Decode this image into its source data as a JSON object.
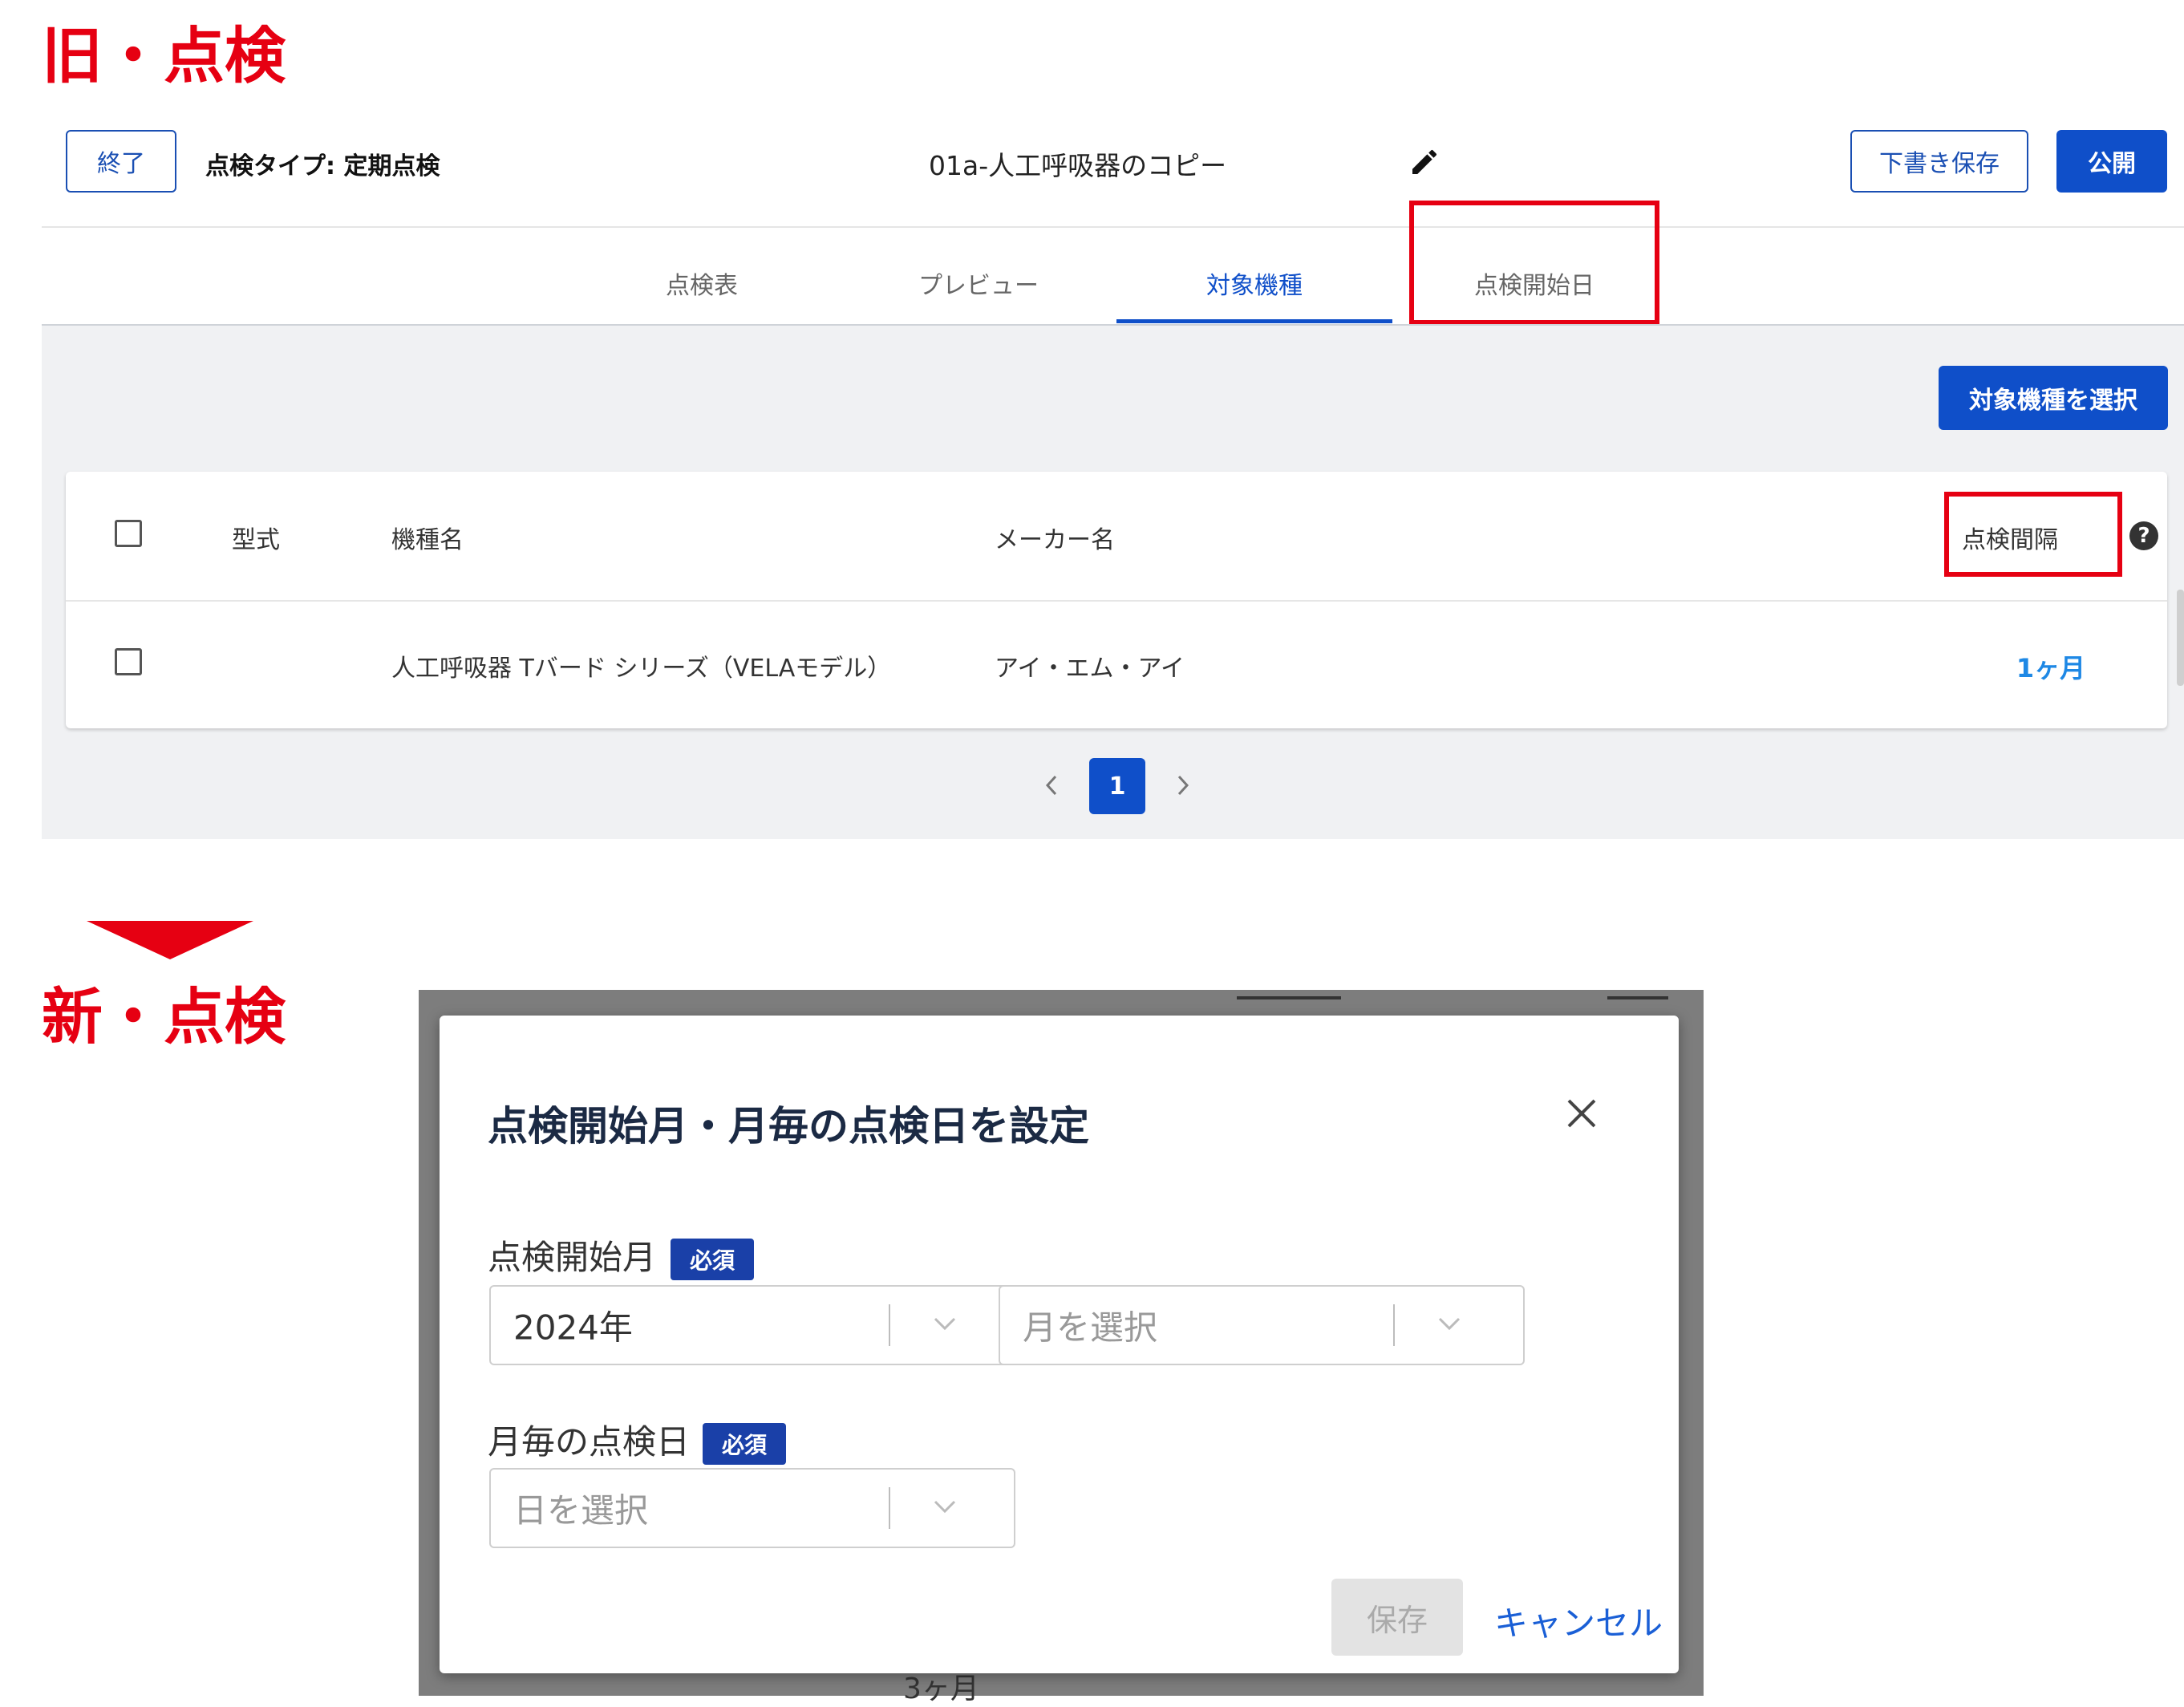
{
  "labels": {
    "old": "旧・点検",
    "new": "新・点検"
  },
  "old_screen": {
    "header": {
      "exit_label": "終了",
      "inspection_type": "点検タイプ: 定期点検",
      "document_title": "01a-人工呼吸器のコピー",
      "draft_save_label": "下書き保存",
      "publish_label": "公開"
    },
    "tabs": [
      {
        "label": "点検表"
      },
      {
        "label": "プレビュー"
      },
      {
        "label": "対象機種"
      },
      {
        "label": "点検開始日"
      }
    ],
    "select_models_label": "対象機種を選択",
    "table": {
      "columns": {
        "model_code": "型式",
        "model_name": "機種名",
        "maker": "メーカー名",
        "interval": "点検間隔"
      },
      "rows": [
        {
          "model_code": "",
          "model_name": "人工呼吸器 Tバード シリーズ（VELAモデル）",
          "maker": "アイ・エム・アイ",
          "interval": "1ヶ月"
        }
      ]
    },
    "pagination": {
      "current_page": "1"
    }
  },
  "new_screen": {
    "dialog": {
      "title": "点検開始月・月毎の点検日を設定",
      "start_month_label": "点検開始月",
      "required_badge": "必須",
      "year_value": "2024年",
      "month_placeholder": "月を選択",
      "day_label": "月毎の点検日",
      "day_placeholder": "日を選択",
      "save_label": "保存",
      "cancel_label": "キャンセル"
    },
    "background_text": "3ヶ月"
  },
  "colors": {
    "accent": "#e60012",
    "primary": "#0f4fc9",
    "badge": "#1a40a8"
  }
}
